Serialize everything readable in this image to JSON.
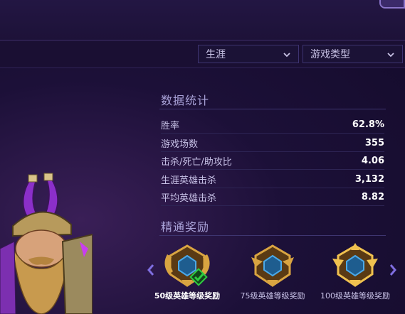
{
  "filters": {
    "career_label": "生涯",
    "mode_label": "游戏类型"
  },
  "stats": {
    "title": "数据统计",
    "rows": [
      {
        "label": "胜率",
        "value": "62.8%"
      },
      {
        "label": "游戏场数",
        "value": "355"
      },
      {
        "label": "击杀/死亡/助攻比",
        "value": "4.06"
      },
      {
        "label": "生涯英雄击杀",
        "value": "3,132"
      },
      {
        "label": "平均英雄击杀",
        "value": "8.82"
      }
    ]
  },
  "mastery": {
    "title": "精通奖励",
    "rewards": [
      {
        "label": "50级英雄等级奖励",
        "selected": true
      },
      {
        "label": "75级英雄等级奖励",
        "selected": false
      },
      {
        "label": "100级英雄等级奖励",
        "selected": false
      }
    ]
  },
  "colors": {
    "accent": "#6c5bd0",
    "check": "#2ecc40",
    "gold": "#d9a441",
    "gem": "#4aa9e9"
  },
  "icons": {
    "dropdown": "chevron-down-icon",
    "prev": "chevron-left-icon",
    "next": "chevron-right-icon",
    "check": "check-icon"
  }
}
